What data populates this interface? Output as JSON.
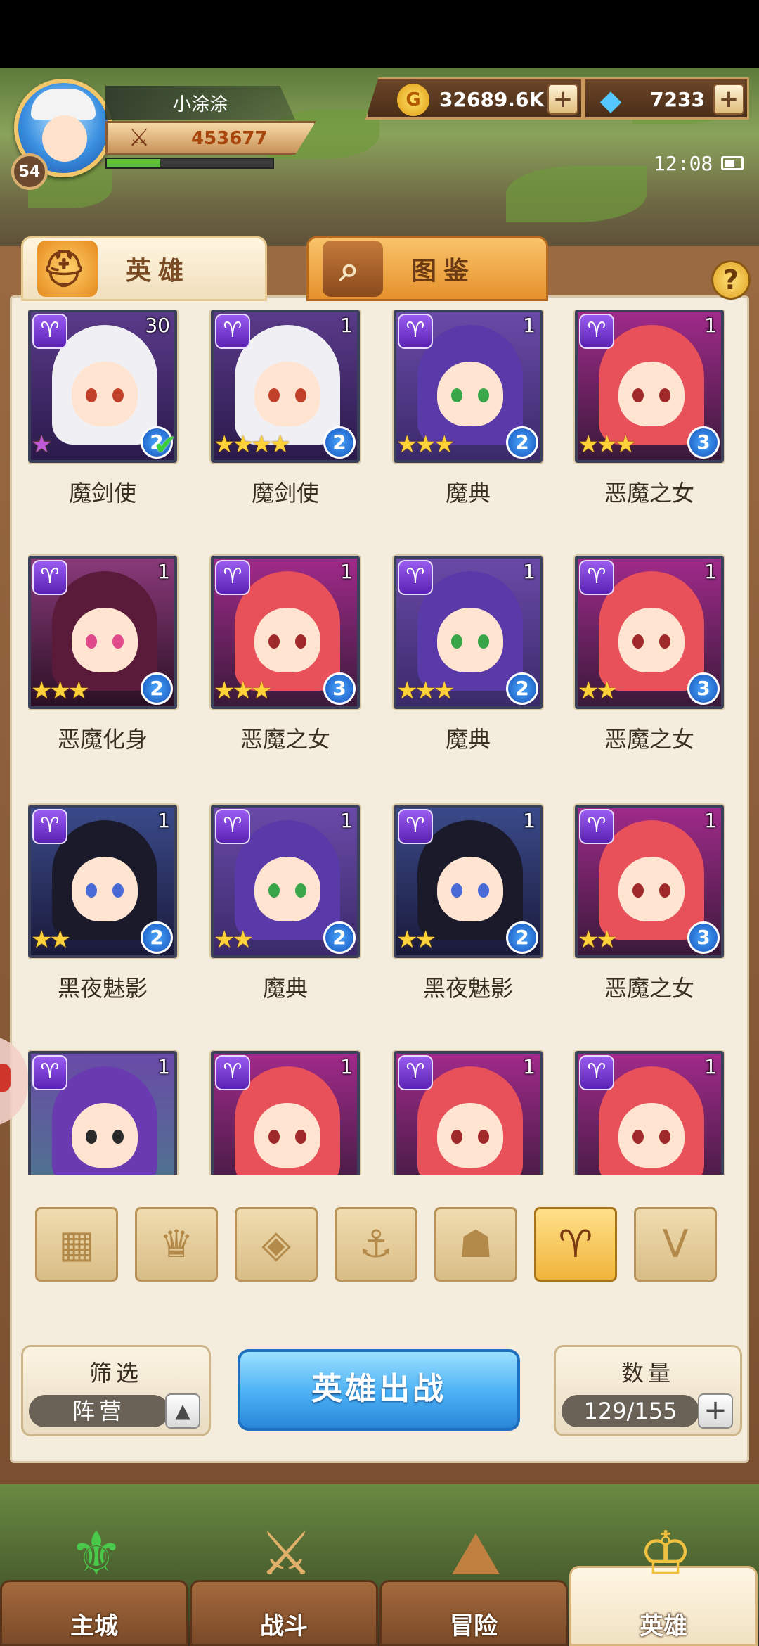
{
  "player": {
    "name": "小涂涂",
    "level": "54",
    "power": "453677",
    "xp_fraction": 0.32
  },
  "currency": {
    "gold": "32689.6K",
    "gems": "7233",
    "gold_icon": "gold-coin-icon",
    "gem_icon": "diamond-icon"
  },
  "clock": "12:08",
  "tabs": {
    "heroes": "英雄",
    "codex": "图鉴"
  },
  "heroes": [
    {
      "name": "魔剑使",
      "level": "1",
      "stars": 1,
      "rank": "2",
      "style": "silver",
      "row": 0,
      "col": 0,
      "level_override": "30"
    },
    {
      "name": "魔剑使",
      "level": "1",
      "stars": 4,
      "rank": "2",
      "style": "silver",
      "row": 0,
      "col": 1
    },
    {
      "name": "魔典",
      "level": "1",
      "stars": 3,
      "rank": "2",
      "style": "purple",
      "row": 0,
      "col": 2
    },
    {
      "name": "恶魔之女",
      "level": "1",
      "stars": 3,
      "rank": "3",
      "style": "red",
      "row": 0,
      "col": 3
    },
    {
      "name": "恶魔化身",
      "level": "1",
      "stars": 3,
      "rank": "2",
      "style": "demon",
      "row": 1,
      "col": 0
    },
    {
      "name": "恶魔之女",
      "level": "1",
      "stars": 3,
      "rank": "3",
      "style": "red",
      "row": 1,
      "col": 1
    },
    {
      "name": "魔典",
      "level": "1",
      "stars": 3,
      "rank": "2",
      "style": "purple",
      "row": 1,
      "col": 2
    },
    {
      "name": "恶魔之女",
      "level": "1",
      "stars": 2,
      "rank": "3",
      "style": "red",
      "row": 1,
      "col": 3
    },
    {
      "name": "黑夜魅影",
      "level": "1",
      "stars": 2,
      "rank": "2",
      "style": "shadow",
      "row": 2,
      "col": 0
    },
    {
      "name": "魔典",
      "level": "1",
      "stars": 2,
      "rank": "2",
      "style": "purple",
      "row": 2,
      "col": 1
    },
    {
      "name": "黑夜魅影",
      "level": "1",
      "stars": 2,
      "rank": "2",
      "style": "shadow",
      "row": 2,
      "col": 2
    },
    {
      "name": "恶魔之女",
      "level": "1",
      "stars": 2,
      "rank": "3",
      "style": "red",
      "row": 2,
      "col": 3
    },
    {
      "name": "",
      "level": "1",
      "stars": 0,
      "rank": "",
      "style": "wizard",
      "row": 3,
      "col": 0
    },
    {
      "name": "",
      "level": "1",
      "stars": 0,
      "rank": "",
      "style": "red",
      "row": 3,
      "col": 1
    },
    {
      "name": "",
      "level": "1",
      "stars": 0,
      "rank": "",
      "style": "red",
      "row": 3,
      "col": 2
    },
    {
      "name": "",
      "level": "1",
      "stars": 0,
      "rank": "",
      "style": "red",
      "row": 3,
      "col": 3
    }
  ],
  "faction_filters": [
    {
      "icon": "grid-all-icon",
      "glyph": "▦",
      "active": false
    },
    {
      "icon": "forest-crown-icon",
      "glyph": "♛",
      "active": false
    },
    {
      "icon": "rank-chevron-icon",
      "glyph": "◈",
      "active": false
    },
    {
      "icon": "anchor-icon",
      "glyph": "⚓",
      "active": false
    },
    {
      "icon": "beast-head-icon",
      "glyph": "☗",
      "active": false
    },
    {
      "icon": "demon-horns-icon",
      "glyph": "♈",
      "active": true
    },
    {
      "icon": "wing-v-icon",
      "glyph": "V",
      "active": false
    }
  ],
  "filter_panel": {
    "title": "筛选",
    "value": "阵营"
  },
  "deploy_button": "英雄出战",
  "count_panel": {
    "title": "数量",
    "value": "129/155"
  },
  "nav": [
    {
      "label": "主城",
      "icon": "city-emblem-icon",
      "glyph": "⚜"
    },
    {
      "label": "战斗",
      "icon": "crossed-swords-icon",
      "glyph": "⚔"
    },
    {
      "label": "冒险",
      "icon": "adventure-map-icon",
      "glyph": "⛰"
    },
    {
      "label": "英雄",
      "icon": "hero-helmet-icon",
      "glyph": "♔"
    }
  ]
}
